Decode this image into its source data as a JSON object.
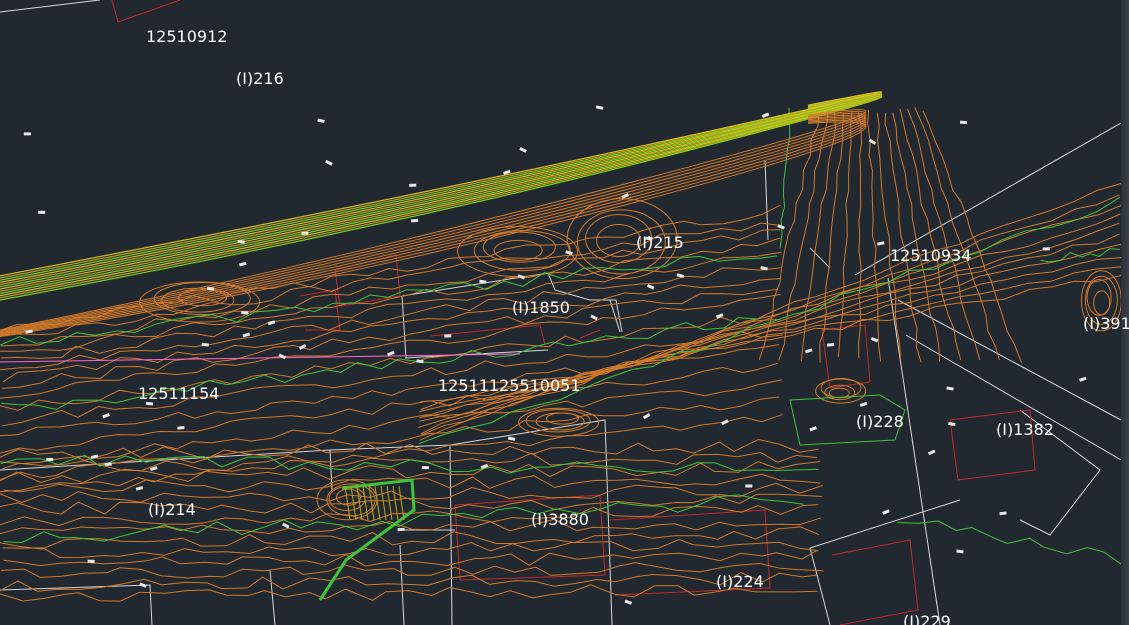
{
  "colors": {
    "background": "#212830",
    "contour_orange": "#d27a2a",
    "contour_green": "#3fc43a",
    "bank_yellow": "#b9a818",
    "parcel_white": "#d8d8d8",
    "building_red": "#c02a2a"
  },
  "labels": {
    "parcel_12510912": "12510912",
    "parcel_216": "(I)216",
    "parcel_215": "(I)215",
    "parcel_1850": "(I)1850",
    "parcel_12510934": "12510934",
    "parcel_391": "(I)391",
    "parcel_12511154": "12511154",
    "parcel_overlap": "12511125510051",
    "parcel_228": "(I)228",
    "parcel_1382": "(I)1382",
    "parcel_214": "(I)214",
    "parcel_3880": "(I)3880",
    "parcel_224": "(I)224",
    "parcel_229": "(I)229"
  }
}
